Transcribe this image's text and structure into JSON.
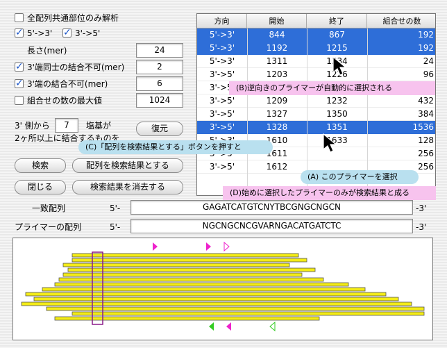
{
  "options": {
    "common_only_label": "全配列共通部位のみ解析",
    "dir_forward_label": "5'->3'",
    "dir_reverse_label": "3'->5'",
    "length_label": "長さ(mer)",
    "length_value": "24",
    "self_bind_label": "3'端同士の結合不可(mer)",
    "self_bind_value": "2",
    "end_bind_label": "3'端の結合不可(mer)",
    "end_bind_value": "6",
    "max_combo_label": "組合せの数の最大値",
    "max_combo_value": "1024",
    "side_prefix": "3' 側から",
    "side_value": "7",
    "side_suffix": "塩基が",
    "side_line2": "2ヶ所以上に結合するものを"
  },
  "buttons": {
    "restore": "復元",
    "search": "検索",
    "set_result": "配列を検索結果とする",
    "close": "閉じる",
    "clear_result": "検索結果を消去する"
  },
  "table": {
    "headers": [
      "方向",
      "開始",
      "終了",
      "組合せの数"
    ],
    "rows": [
      {
        "dir": "5'->3'",
        "start": "844",
        "end": "867",
        "count": "192",
        "selected": true
      },
      {
        "dir": "5'->3'",
        "start": "1192",
        "end": "1215",
        "count": "192",
        "selected": true
      },
      {
        "dir": "5'->3'",
        "start": "1311",
        "end": "1334",
        "count": "24",
        "selected": false
      },
      {
        "dir": "3'->5'",
        "start": "1203",
        "end": "1226",
        "count": "96",
        "selected": false
      },
      {
        "dir": "3'->5'",
        "start": "",
        "end": "",
        "count": "",
        "selected": false
      },
      {
        "dir": "3'->5'",
        "start": "1209",
        "end": "1232",
        "count": "432",
        "selected": false
      },
      {
        "dir": "3'->5'",
        "start": "1327",
        "end": "1350",
        "count": "384",
        "selected": false
      },
      {
        "dir": "3'->5'",
        "start": "1328",
        "end": "1351",
        "count": "1536",
        "selected": true
      },
      {
        "dir": "5'->3'",
        "start": "1610",
        "end": "1633",
        "count": "128",
        "selected": false
      },
      {
        "dir": "3'->5'",
        "start": "1611",
        "end": "",
        "count": "256",
        "selected": false
      },
      {
        "dir": "3'->5'",
        "start": "1612",
        "end": "",
        "count": "256",
        "selected": false
      }
    ]
  },
  "sequences": {
    "match_label": "一致配列",
    "match_prefix": "5'-",
    "match_value": "GAGATCATGTCNYTBCGNGCNGCN",
    "match_suffix": "-3'",
    "primer_label": "プライマーの配列",
    "primer_prefix": "5'-",
    "primer_value": "NGCNGCNCGVARNGACATGATCTC",
    "primer_suffix": "-3'"
  },
  "callouts": {
    "a": "(A) このプライマーを選択",
    "b": "(B)逆向きのプライマーが自動的に選択される",
    "c": "(C)「配列を検索結果とする」ボタンを押すと",
    "d": "(D)始めに選択したプライマーのみが検索結果と成る"
  },
  "colors": {
    "selection": "#2e6ed8",
    "bar_fill": "#f4ec16",
    "marker_pink": "#ee22cc",
    "marker_green": "#33cc22",
    "frame": "#8a1a8a"
  },
  "panel_bars": [
    {
      "start": 0.14,
      "end": 0.68
    },
    {
      "start": 0.14,
      "end": 0.7
    },
    {
      "start": 0.12,
      "end": 0.66
    },
    {
      "start": 0.13,
      "end": 0.72
    },
    {
      "start": 0.12,
      "end": 0.69
    },
    {
      "start": 0.11,
      "end": 0.74
    },
    {
      "start": 0.1,
      "end": 0.8
    },
    {
      "start": 0.07,
      "end": 0.84
    },
    {
      "start": 0.03,
      "end": 0.89
    },
    {
      "start": 0.05,
      "end": 0.92
    },
    {
      "start": 0.02,
      "end": 0.95
    },
    {
      "start": 0.08,
      "end": 0.98
    },
    {
      "start": 0.14,
      "end": 0.98
    },
    {
      "start": 0.1,
      "end": 0.73
    }
  ]
}
